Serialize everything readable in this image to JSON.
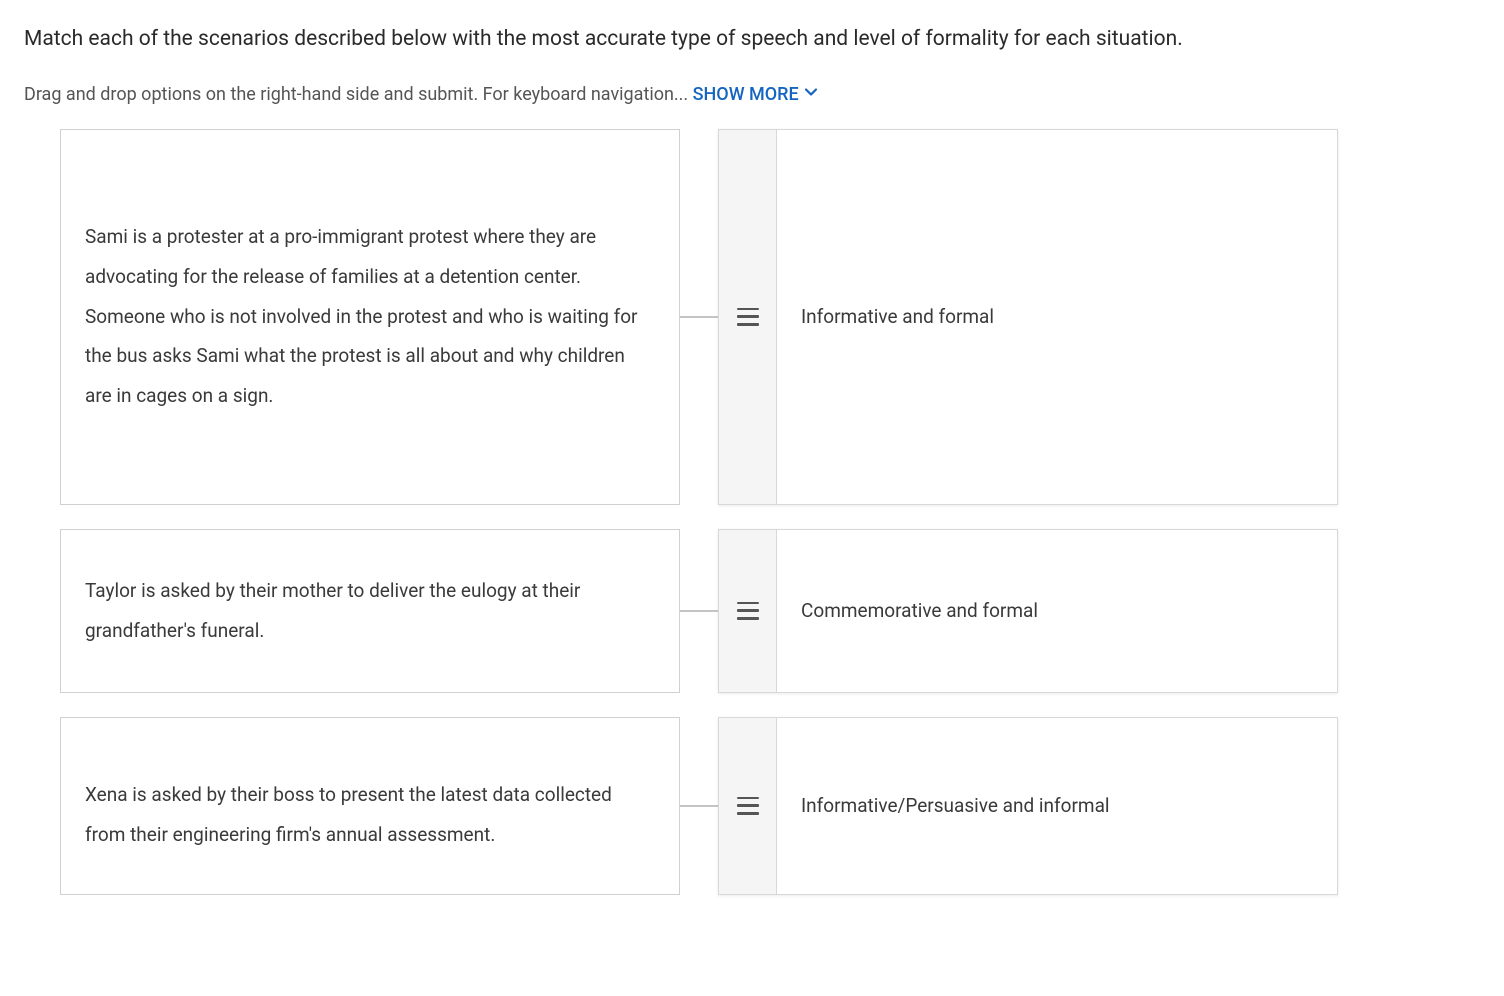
{
  "question": "Match each of the scenarios described below with the most accurate type of speech and level of formality for each situation.",
  "instructions_prefix": "Drag and drop options on the right-hand side and submit. For keyboard navigation... ",
  "show_more_label": "SHOW MORE",
  "rows": [
    {
      "scenario": "Sami is a protester at a pro-immigrant protest where they are advocating for the release of families at a detention center. Someone who is not involved in the protest and who is waiting for the bus asks Sami what the protest is all about and why children are in cages on a sign.",
      "answer": "Informative and formal"
    },
    {
      "scenario": "Taylor is asked by their mother to deliver the eulogy at their grandfather's funeral.",
      "answer": "Commemorative and formal"
    },
    {
      "scenario": "Xena is asked by their boss to present the latest data collected from their engineering firm's annual assessment.",
      "answer": "Informative/Persuasive and informal"
    }
  ]
}
